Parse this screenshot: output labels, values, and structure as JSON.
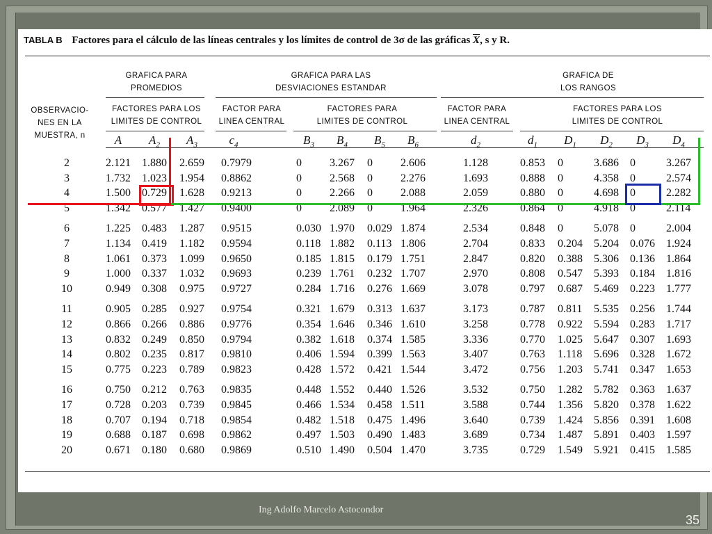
{
  "caption": {
    "tabla": "TABLA B",
    "text": "Factores para el cálculo de las líneas centrales y los límites de control de 3σ de las gráficas",
    "xbar": "X",
    "tail": ", s y R."
  },
  "headers": {
    "observaciones": [
      "OBSERVACIO-",
      "NES EN LA",
      "MUESTRA, n"
    ],
    "grafica_promedios": [
      "GRAFICA PARA",
      "PROMEDIOS"
    ],
    "grafica_desviaciones": [
      "GRAFICA PARA LAS",
      "DESVIACIONES ESTANDAR"
    ],
    "grafica_rangos": [
      "GRAFICA DE",
      "LOS RANGOS"
    ],
    "factores_limites_1": [
      "FACTORES PARA LOS",
      "LIMITES DE CONTROL"
    ],
    "factor_central_1": [
      "FACTOR PARA",
      "LINEA CENTRAL"
    ],
    "factores_limites_2": [
      "FACTORES PARA",
      "LIMITES DE CONTROL"
    ],
    "factor_central_2": [
      "FACTOR PARA",
      "LINEA CENTRAL"
    ],
    "factores_limites_3": [
      "FACTORES PARA LOS",
      "LIMITES DE CONTROL"
    ]
  },
  "symbols": [
    {
      "base": "A",
      "sub": ""
    },
    {
      "base": "A",
      "sub": "2"
    },
    {
      "base": "A",
      "sub": "3"
    },
    {
      "base": "c",
      "sub": "4"
    },
    {
      "base": "B",
      "sub": "3"
    },
    {
      "base": "B",
      "sub": "4"
    },
    {
      "base": "B",
      "sub": "5"
    },
    {
      "base": "B",
      "sub": "6"
    },
    {
      "base": "d",
      "sub": "2"
    },
    {
      "base": "d",
      "sub": "1"
    },
    {
      "base": "D",
      "sub": "1"
    },
    {
      "base": "D",
      "sub": "2"
    },
    {
      "base": "D",
      "sub": "3"
    },
    {
      "base": "D",
      "sub": "4"
    }
  ],
  "rows": [
    [
      "2",
      "2.121",
      "1.880",
      "2.659",
      "0.7979",
      "0",
      "3.267",
      "0",
      "2.606",
      "1.128",
      "0.853",
      "0",
      "3.686",
      "0",
      "3.267"
    ],
    [
      "3",
      "1.732",
      "1.023",
      "1.954",
      "0.8862",
      "0",
      "2.568",
      "0",
      "2.276",
      "1.693",
      "0.888",
      "0",
      "4.358",
      "0",
      "2.574"
    ],
    [
      "4",
      "1.500",
      "0.729",
      "1.628",
      "0.9213",
      "0",
      "2.266",
      "0",
      "2.088",
      "2.059",
      "0.880",
      "0",
      "4.698",
      "0",
      "2.282"
    ],
    [
      "5",
      "1.342",
      "0.577",
      "1.427",
      "0.9400",
      "0",
      "2.089",
      "0",
      "1.964",
      "2.326",
      "0.864",
      "0",
      "4.918",
      "0",
      "2.114"
    ],
    [
      "6",
      "1.225",
      "0.483",
      "1.287",
      "0.9515",
      "0.030",
      "1.970",
      "0.029",
      "1.874",
      "2.534",
      "0.848",
      "0",
      "5.078",
      "0",
      "2.004"
    ],
    [
      "7",
      "1.134",
      "0.419",
      "1.182",
      "0.9594",
      "0.118",
      "1.882",
      "0.113",
      "1.806",
      "2.704",
      "0.833",
      "0.204",
      "5.204",
      "0.076",
      "1.924"
    ],
    [
      "8",
      "1.061",
      "0.373",
      "1.099",
      "0.9650",
      "0.185",
      "1.815",
      "0.179",
      "1.751",
      "2.847",
      "0.820",
      "0.388",
      "5.306",
      "0.136",
      "1.864"
    ],
    [
      "9",
      "1.000",
      "0.337",
      "1.032",
      "0.9693",
      "0.239",
      "1.761",
      "0.232",
      "1.707",
      "2.970",
      "0.808",
      "0.547",
      "5.393",
      "0.184",
      "1.816"
    ],
    [
      "10",
      "0.949",
      "0.308",
      "0.975",
      "0.9727",
      "0.284",
      "1.716",
      "0.276",
      "1.669",
      "3.078",
      "0.797",
      "0.687",
      "5.469",
      "0.223",
      "1.777"
    ],
    [
      "11",
      "0.905",
      "0.285",
      "0.927",
      "0.9754",
      "0.321",
      "1.679",
      "0.313",
      "1.637",
      "3.173",
      "0.787",
      "0.811",
      "5.535",
      "0.256",
      "1.744"
    ],
    [
      "12",
      "0.866",
      "0.266",
      "0.886",
      "0.9776",
      "0.354",
      "1.646",
      "0.346",
      "1.610",
      "3.258",
      "0.778",
      "0.922",
      "5.594",
      "0.283",
      "1.717"
    ],
    [
      "13",
      "0.832",
      "0.249",
      "0.850",
      "0.9794",
      "0.382",
      "1.618",
      "0.374",
      "1.585",
      "3.336",
      "0.770",
      "1.025",
      "5.647",
      "0.307",
      "1.693"
    ],
    [
      "14",
      "0.802",
      "0.235",
      "0.817",
      "0.9810",
      "0.406",
      "1.594",
      "0.399",
      "1.563",
      "3.407",
      "0.763",
      "1.118",
      "5.696",
      "0.328",
      "1.672"
    ],
    [
      "15",
      "0.775",
      "0.223",
      "0.789",
      "0.9823",
      "0.428",
      "1.572",
      "0.421",
      "1.544",
      "3.472",
      "0.756",
      "1.203",
      "5.741",
      "0.347",
      "1.653"
    ],
    [
      "16",
      "0.750",
      "0.212",
      "0.763",
      "0.9835",
      "0.448",
      "1.552",
      "0.440",
      "1.526",
      "3.532",
      "0.750",
      "1.282",
      "5.782",
      "0.363",
      "1.637"
    ],
    [
      "17",
      "0.728",
      "0.203",
      "0.739",
      "0.9845",
      "0.466",
      "1.534",
      "0.458",
      "1.511",
      "3.588",
      "0.744",
      "1.356",
      "5.820",
      "0.378",
      "1.622"
    ],
    [
      "18",
      "0.707",
      "0.194",
      "0.718",
      "0.9854",
      "0.482",
      "1.518",
      "0.475",
      "1.496",
      "3.640",
      "0.739",
      "1.424",
      "5.856",
      "0.391",
      "1.608"
    ],
    [
      "19",
      "0.688",
      "0.187",
      "0.698",
      "0.9862",
      "0.497",
      "1.503",
      "0.490",
      "1.483",
      "3.689",
      "0.734",
      "1.487",
      "5.891",
      "0.403",
      "1.597"
    ],
    [
      "20",
      "0.671",
      "0.180",
      "0.680",
      "0.9869",
      "0.510",
      "1.490",
      "0.504",
      "1.470",
      "3.735",
      "0.729",
      "1.549",
      "5.921",
      "0.415",
      "1.585"
    ]
  ],
  "footer": {
    "author": "Ing Adolfo Marcelo Astocondor",
    "slide_number": "35"
  },
  "colors": {
    "highlight_red": "#e8141c",
    "highlight_green": "#2bbd2b",
    "highlight_blue": "#1a2ea8"
  }
}
